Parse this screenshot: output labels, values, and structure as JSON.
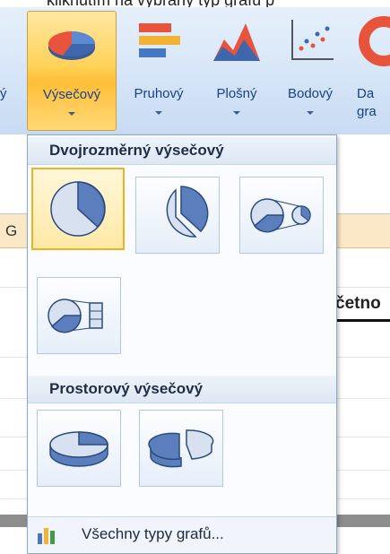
{
  "caption": "kliknutím na vybraný typ grafu p",
  "ribbon": {
    "left_cut_label": "ý",
    "buttons": [
      {
        "label": "Výsečový",
        "active": true
      },
      {
        "label": "Pruhový"
      },
      {
        "label": "Plošný"
      },
      {
        "label": "Bodový"
      },
      {
        "label": "Da grafy",
        "label_line1": "Da",
        "label_line2": "gra"
      }
    ]
  },
  "sheet": {
    "col_letter": "G",
    "header_text": "četno"
  },
  "menu": {
    "section_2d": "Dvojrozměrný výsečový",
    "section_3d": "Prostorový výsečový",
    "footer_label": "Všechny typy grafů..."
  },
  "colors": {
    "accent_blue": "#15428b",
    "selected_border": "#efb21f",
    "pie_fill": "#5b7fbd"
  }
}
